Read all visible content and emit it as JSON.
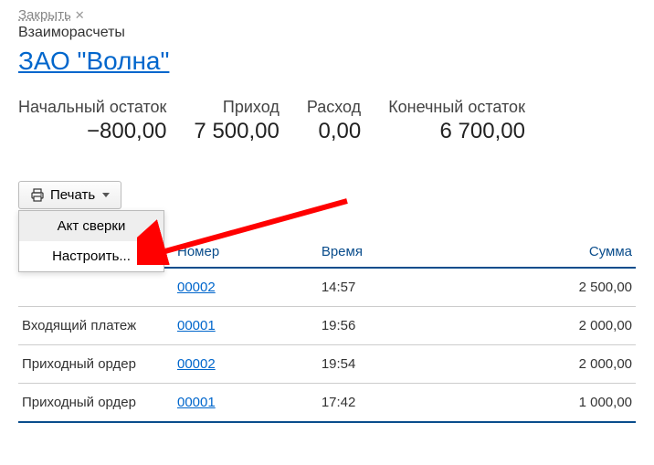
{
  "close_label": "Закрыть",
  "breadcrumb": "Взаиморасчеты",
  "title": "ЗАО \"Волна\"",
  "summary": {
    "start_label": "Начальный остаток",
    "start_value": "−800,00",
    "income_label": "Приход",
    "income_value": "7 500,00",
    "expense_label": "Расход",
    "expense_value": "0,00",
    "end_label": "Конечный остаток",
    "end_value": "6 700,00"
  },
  "print_button": "Печать",
  "dropdown": {
    "item1": "Акт сверки",
    "item2": "Настроить..."
  },
  "columns": {
    "number": "Номер",
    "time": "Время",
    "sum": "Сумма"
  },
  "rows": [
    {
      "type_partial": "",
      "number": "00002",
      "time": "14:57",
      "sum": "2 500,00"
    },
    {
      "type": "Входящий платеж",
      "number": "00001",
      "time": "19:56",
      "sum": "2 000,00"
    },
    {
      "type": "Приходный ордер",
      "number": "00002",
      "time": "19:54",
      "sum": "2 000,00"
    },
    {
      "type": "Приходный ордер",
      "number": "00001",
      "time": "17:42",
      "sum": "1 000,00"
    }
  ]
}
